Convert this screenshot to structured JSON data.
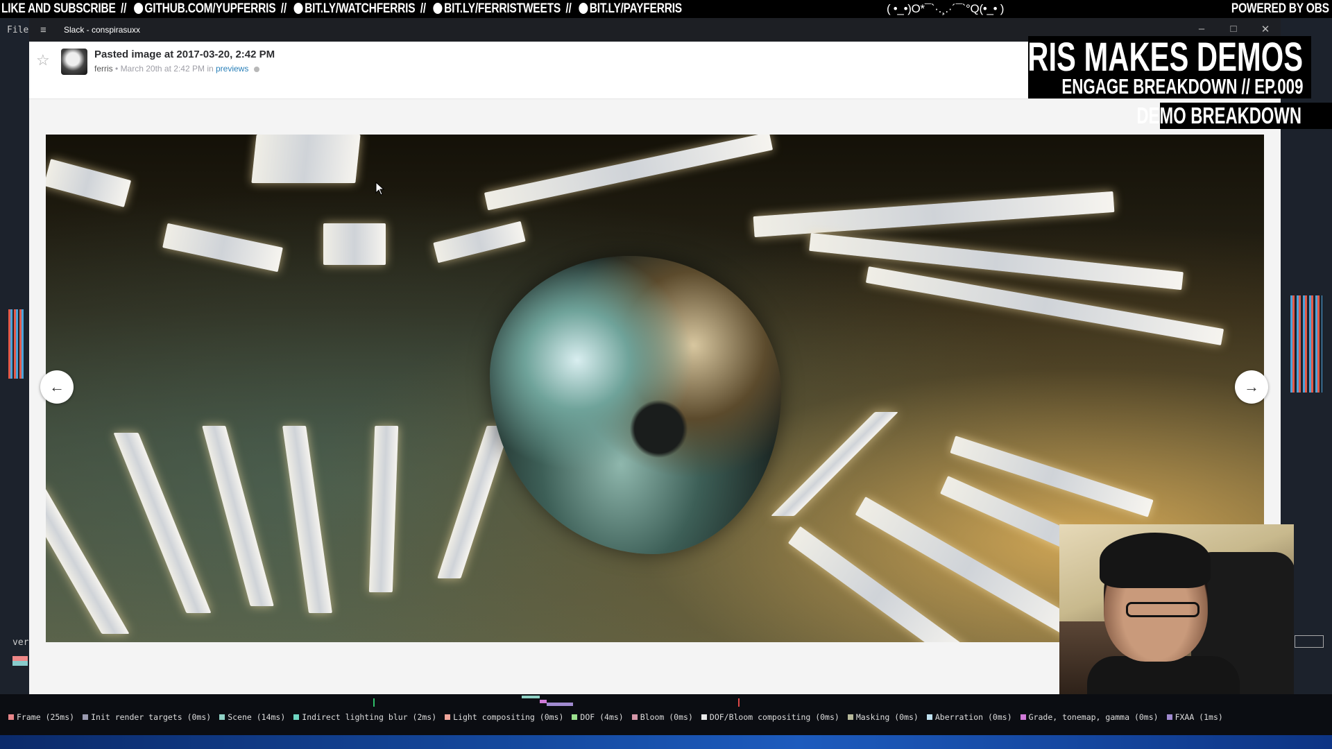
{
  "stream_banner": {
    "left_parts": [
      "LIKE AND SUBSCRIBE",
      "GITHUB.COM/YUPFERRIS",
      "BIT.LY/WATCHFERRIS",
      "BIT.LY/FERRISTWEETS",
      "BIT.LY/PAYFERRIS"
    ],
    "separator": "//",
    "icons": [
      "github-icon",
      "twitch-icon",
      "twitter-icon",
      "patreon-icon"
    ],
    "emoticon": "( •_•)O*¯`·.¸.·´¯`°Q(•_• )",
    "right": "POWERED BY OBS"
  },
  "background_app": {
    "menu": "File",
    "version_prefix": "ver"
  },
  "window": {
    "title": "Slack - conspirasuxx",
    "controls": [
      "minimize-icon",
      "maximize-icon",
      "close-icon"
    ]
  },
  "file_header": {
    "title": "Pasted image at 2017-03-20, 2:42 PM",
    "user": "ferris",
    "bullet": "•",
    "date": "March 20th at 2:42 PM",
    "in_word": "in",
    "channel": "previews",
    "star_icon": "star-icon"
  },
  "image_viewer": {
    "prev_icon": "arrow-left-icon",
    "next_icon": "arrow-right-icon",
    "prev_glyph": "←",
    "next_glyph": "→"
  },
  "overlay": {
    "title": "FERRIS MAKES DEMOS",
    "episode": "ENGAGE BREAKDOWN // EP.009",
    "segment": "DEMO BREAKDOWN"
  },
  "profiler": {
    "timings": [
      {
        "label": "Frame (25ms)",
        "color": "#e8868a"
      },
      {
        "label": "Init render targets (0ms)",
        "color": "#9a9ab0"
      },
      {
        "label": "Scene (14ms)",
        "color": "#8fd0c4"
      },
      {
        "label": "Indirect lighting blur (2ms)",
        "color": "#6fd6c2"
      },
      {
        "label": "Light compositing (0ms)",
        "color": "#f0a59a"
      },
      {
        "label": "DOF (4ms)",
        "color": "#9be08e"
      },
      {
        "label": "Bloom (0ms)",
        "color": "#d496a8"
      },
      {
        "label": "DOF/Bloom compositing (0ms)",
        "color": "#e8e8e8"
      },
      {
        "label": "Masking (0ms)",
        "color": "#b6b89a"
      },
      {
        "label": "Aberration (0ms)",
        "color": "#bfe0f0"
      },
      {
        "label": "Grade, tonemap, gamma (0ms)",
        "color": "#d07ad8"
      },
      {
        "label": "FXAA (1ms)",
        "color": "#a08ad0"
      }
    ]
  },
  "colors": {
    "slack_link": "#2a80b9",
    "titlebar": "#1d1f24"
  }
}
